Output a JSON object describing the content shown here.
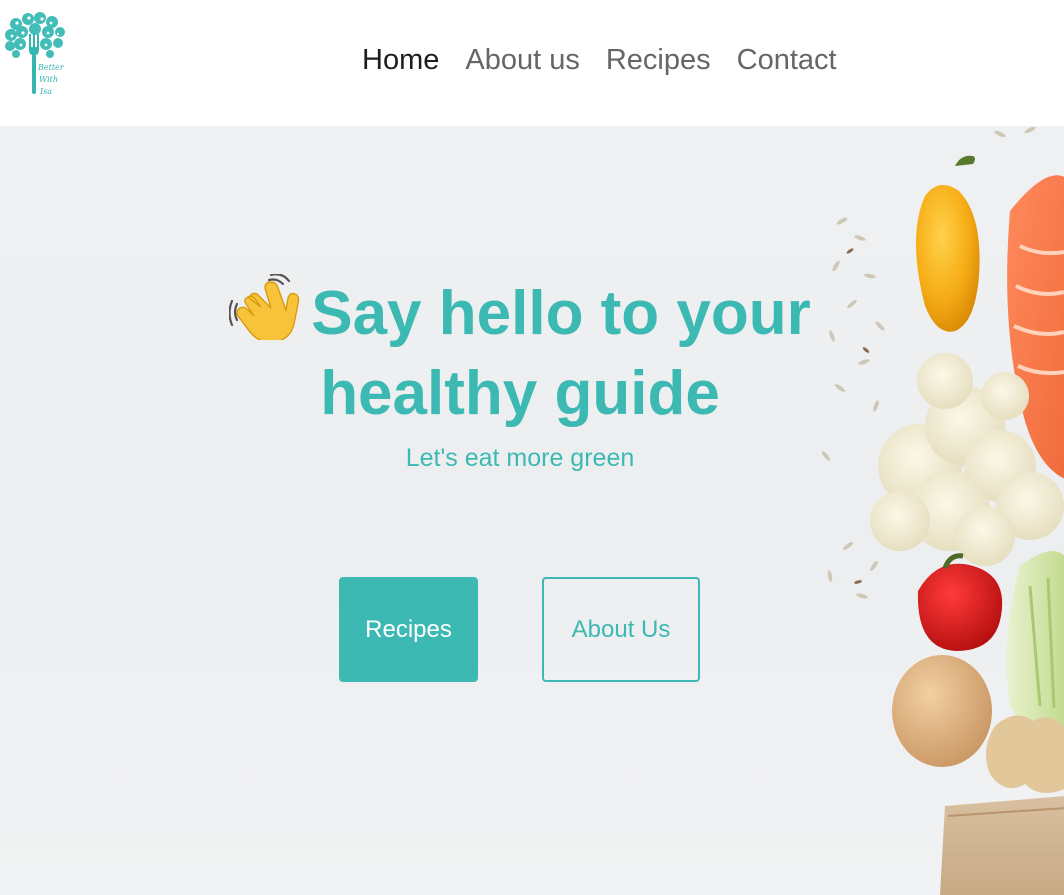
{
  "logo": {
    "lines": [
      "Better",
      "With",
      "Isa"
    ]
  },
  "nav": {
    "items": [
      {
        "label": "Home",
        "active": true
      },
      {
        "label": "About us",
        "active": false
      },
      {
        "label": "Recipes",
        "active": false
      },
      {
        "label": "Contact",
        "active": false
      }
    ]
  },
  "hero": {
    "title": "Say hello to your healthy guide",
    "subtitle": "Let's eat more green",
    "wave_icon": "waving-hand-icon",
    "buttons": {
      "primary_label": "Recipes",
      "secondary_label": "About Us"
    }
  },
  "colors": {
    "accent": "#3cb9b3",
    "nav_active": "#1d1d1d",
    "nav_inactive": "#666666"
  }
}
